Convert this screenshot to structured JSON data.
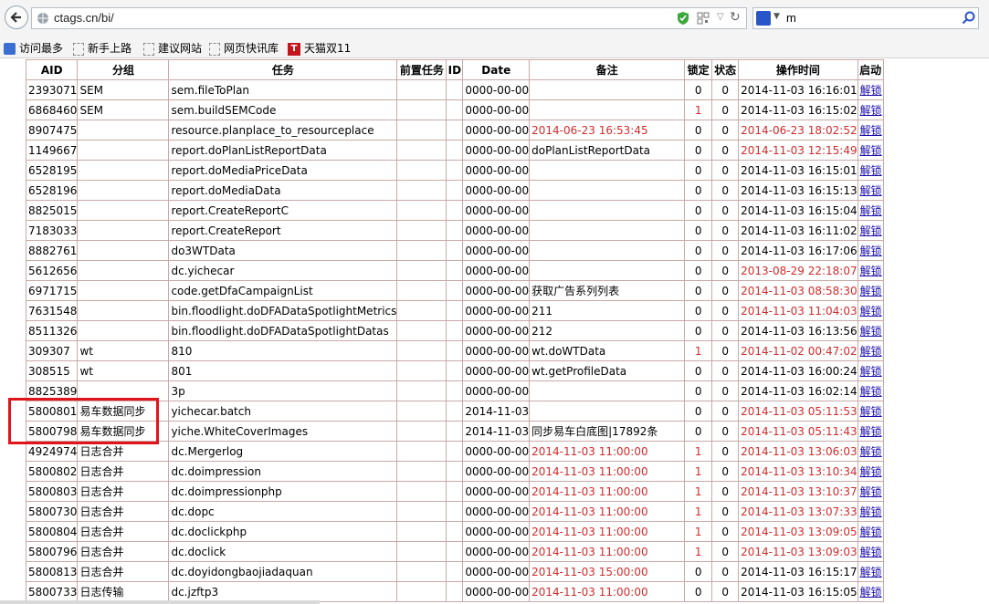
{
  "browser": {
    "url": "ctags.cn/bi/",
    "search_text": "m"
  },
  "bookmarks": [
    "访问最多",
    "新手上路",
    "建议网站",
    "网页快讯库",
    "天猫双11"
  ],
  "bookmark_tmall_glyph": "T",
  "table": {
    "headers": [
      "AID",
      "分组",
      "任务",
      "前置任务",
      "ID",
      "Date",
      "备注",
      "锁定",
      "状态",
      "操作时间",
      "启动"
    ],
    "rows": [
      {
        "aid": "2393071",
        "group": "SEM",
        "task": "sem.fileToPlan",
        "pre": "",
        "id": "",
        "date": "0000-00-00",
        "note": "",
        "note_red": false,
        "lock": "0",
        "lock_red": false,
        "status": "0",
        "time": "2014-11-03 16:16:01",
        "time_red": false,
        "action": "解锁"
      },
      {
        "aid": "6868460",
        "group": "SEM",
        "task": "sem.buildSEMCode",
        "pre": "",
        "id": "",
        "date": "0000-00-00",
        "note": "",
        "note_red": false,
        "lock": "1",
        "lock_red": true,
        "status": "0",
        "time": "2014-11-03 16:15:02",
        "time_red": false,
        "action": "解锁"
      },
      {
        "aid": "8907475",
        "group": "",
        "task": "resource.planplace_to_resourceplace",
        "pre": "",
        "id": "",
        "date": "0000-00-00",
        "note": "2014-06-23 16:53:45",
        "note_red": true,
        "lock": "0",
        "lock_red": false,
        "status": "0",
        "time": "2014-06-23 18:02:52",
        "time_red": true,
        "action": "解锁"
      },
      {
        "aid": "1149667",
        "group": "",
        "task": "report.doPlanListReportData",
        "pre": "",
        "id": "",
        "date": "0000-00-00",
        "note": "doPlanListReportData",
        "note_red": false,
        "lock": "0",
        "lock_red": false,
        "status": "0",
        "time": "2014-11-03 12:15:49",
        "time_red": true,
        "action": "解锁"
      },
      {
        "aid": "6528195",
        "group": "",
        "task": "report.doMediaPriceData",
        "pre": "",
        "id": "",
        "date": "0000-00-00",
        "note": "",
        "note_red": false,
        "lock": "0",
        "lock_red": false,
        "status": "0",
        "time": "2014-11-03 16:15:01",
        "time_red": false,
        "action": "解锁"
      },
      {
        "aid": "6528196",
        "group": "",
        "task": "report.doMediaData",
        "pre": "",
        "id": "",
        "date": "0000-00-00",
        "note": "",
        "note_red": false,
        "lock": "0",
        "lock_red": false,
        "status": "0",
        "time": "2014-11-03 16:15:13",
        "time_red": false,
        "action": "解锁"
      },
      {
        "aid": "8825015",
        "group": "",
        "task": "report.CreateReportC",
        "pre": "",
        "id": "",
        "date": "0000-00-00",
        "note": "",
        "note_red": false,
        "lock": "0",
        "lock_red": false,
        "status": "0",
        "time": "2014-11-03 16:15:04",
        "time_red": false,
        "action": "解锁"
      },
      {
        "aid": "7183033",
        "group": "",
        "task": "report.CreateReport",
        "pre": "",
        "id": "",
        "date": "0000-00-00",
        "note": "",
        "note_red": false,
        "lock": "0",
        "lock_red": false,
        "status": "0",
        "time": "2014-11-03 16:11:02",
        "time_red": false,
        "action": "解锁"
      },
      {
        "aid": "8882761",
        "group": "",
        "task": "do3WTData",
        "pre": "",
        "id": "",
        "date": "0000-00-00",
        "note": "",
        "note_red": false,
        "lock": "0",
        "lock_red": false,
        "status": "0",
        "time": "2014-11-03 16:17:06",
        "time_red": false,
        "action": "解锁"
      },
      {
        "aid": "5612656",
        "group": "",
        "task": "dc.yichecar",
        "pre": "",
        "id": "",
        "date": "0000-00-00",
        "note": "",
        "note_red": false,
        "lock": "0",
        "lock_red": false,
        "status": "0",
        "time": "2013-08-29 22:18:07",
        "time_red": true,
        "action": "解锁"
      },
      {
        "aid": "6971715",
        "group": "",
        "task": "code.getDfaCampaignList",
        "pre": "",
        "id": "",
        "date": "0000-00-00",
        "note": "获取广告系列列表",
        "note_red": false,
        "lock": "0",
        "lock_red": false,
        "status": "0",
        "time": "2014-11-03 08:58:30",
        "time_red": true,
        "action": "解锁"
      },
      {
        "aid": "7631548",
        "group": "",
        "task": "bin.floodlight.doDFADataSpotlightMetrics",
        "pre": "",
        "id": "",
        "date": "0000-00-00",
        "note": "211",
        "note_red": false,
        "lock": "0",
        "lock_red": false,
        "status": "0",
        "time": "2014-11-03 11:04:03",
        "time_red": true,
        "action": "解锁"
      },
      {
        "aid": "8511326",
        "group": "",
        "task": "bin.floodlight.doDFADataSpotlightDatas",
        "pre": "",
        "id": "",
        "date": "0000-00-00",
        "note": "212",
        "note_red": false,
        "lock": "0",
        "lock_red": false,
        "status": "0",
        "time": "2014-11-03 16:13:56",
        "time_red": false,
        "action": "解锁"
      },
      {
        "aid": "309307",
        "group": "wt",
        "task": "810",
        "pre": "",
        "id": "",
        "date": "0000-00-00",
        "note": "wt.doWTData",
        "note_red": false,
        "lock": "1",
        "lock_red": true,
        "status": "0",
        "time": "2014-11-02 00:47:02",
        "time_red": true,
        "action": "解锁"
      },
      {
        "aid": "308515",
        "group": "wt",
        "task": "801",
        "pre": "",
        "id": "",
        "date": "0000-00-00",
        "note": "wt.getProfileData",
        "note_red": false,
        "lock": "0",
        "lock_red": false,
        "status": "0",
        "time": "2014-11-03 16:00:24",
        "time_red": false,
        "action": "解锁"
      },
      {
        "aid": "8825389",
        "group": "",
        "task": "3p",
        "pre": "",
        "id": "",
        "date": "0000-00-00",
        "note": "",
        "note_red": false,
        "lock": "0",
        "lock_red": false,
        "status": "0",
        "time": "2014-11-03 16:02:14",
        "time_red": false,
        "action": "解锁"
      },
      {
        "aid": "5800801",
        "group": "易车数据同步",
        "task": "yichecar.batch",
        "pre": "",
        "id": "",
        "date": "2014-11-03",
        "note": "",
        "note_red": false,
        "lock": "0",
        "lock_red": false,
        "status": "0",
        "time": "2014-11-03 05:11:53",
        "time_red": true,
        "action": "解锁"
      },
      {
        "aid": "5800798",
        "group": "易车数据同步",
        "task": "yiche.WhiteCoverImages",
        "pre": "",
        "id": "",
        "date": "2014-11-03",
        "note": "同步易车白底图|17892条",
        "note_red": false,
        "lock": "0",
        "lock_red": false,
        "status": "0",
        "time": "2014-11-03 05:11:43",
        "time_red": true,
        "action": "解锁"
      },
      {
        "aid": "4924974",
        "group": "日志合并",
        "task": "dc.Mergerlog",
        "pre": "",
        "id": "",
        "date": "0000-00-00",
        "note": "2014-11-03 11:00:00",
        "note_red": true,
        "lock": "1",
        "lock_red": true,
        "status": "0",
        "time": "2014-11-03 13:06:03",
        "time_red": true,
        "action": "解锁"
      },
      {
        "aid": "5800802",
        "group": "日志合并",
        "task": "dc.doimpression",
        "pre": "",
        "id": "",
        "date": "0000-00-00",
        "note": "2014-11-03 11:00:00",
        "note_red": true,
        "lock": "1",
        "lock_red": true,
        "status": "0",
        "time": "2014-11-03 13:10:34",
        "time_red": true,
        "action": "解锁"
      },
      {
        "aid": "5800803",
        "group": "日志合并",
        "task": "dc.doimpressionphp",
        "pre": "",
        "id": "",
        "date": "0000-00-00",
        "note": "2014-11-03 11:00:00",
        "note_red": true,
        "lock": "1",
        "lock_red": true,
        "status": "0",
        "time": "2014-11-03 13:10:37",
        "time_red": true,
        "action": "解锁"
      },
      {
        "aid": "5800730",
        "group": "日志合并",
        "task": "dc.dopc",
        "pre": "",
        "id": "",
        "date": "0000-00-00",
        "note": "2014-11-03 11:00:00",
        "note_red": true,
        "lock": "1",
        "lock_red": true,
        "status": "0",
        "time": "2014-11-03 13:07:33",
        "time_red": true,
        "action": "解锁"
      },
      {
        "aid": "5800804",
        "group": "日志合并",
        "task": "dc.doclickphp",
        "pre": "",
        "id": "",
        "date": "0000-00-00",
        "note": "2014-11-03 11:00:00",
        "note_red": true,
        "lock": "1",
        "lock_red": true,
        "status": "0",
        "time": "2014-11-03 13:09:05",
        "time_red": true,
        "action": "解锁"
      },
      {
        "aid": "5800796",
        "group": "日志合并",
        "task": "dc.doclick",
        "pre": "",
        "id": "",
        "date": "0000-00-00",
        "note": "2014-11-03 11:00:00",
        "note_red": true,
        "lock": "1",
        "lock_red": true,
        "status": "0",
        "time": "2014-11-03 13:09:03",
        "time_red": true,
        "action": "解锁"
      },
      {
        "aid": "5800813",
        "group": "日志合并",
        "task": "dc.doyidongbaojiadaquan",
        "pre": "",
        "id": "",
        "date": "0000-00-00",
        "note": "2014-11-03 15:00:00",
        "note_red": true,
        "lock": "0",
        "lock_red": false,
        "status": "0",
        "time": "2014-11-03 16:15:17",
        "time_red": false,
        "action": "解锁"
      },
      {
        "aid": "5800733",
        "group": "日志传输",
        "task": "dc.jzftp3",
        "pre": "",
        "id": "",
        "date": "0000-00-00",
        "note": "2014-11-03 11:00:00",
        "note_red": true,
        "lock": "0",
        "lock_red": false,
        "status": "0",
        "time": "2014-11-03 16:15:05",
        "time_red": false,
        "action": "解锁"
      }
    ]
  },
  "colors": {
    "red_text": "#d12b2b",
    "highlight": "#e0151b",
    "link": "#1a0dab",
    "grid": "#c9a9a9"
  },
  "icons": [
    "back-arrow-icon",
    "globe-icon",
    "shield-icon",
    "qr-code-icon",
    "dropdown-icon",
    "reload-icon",
    "search-engine-icon",
    "search-icon"
  ]
}
